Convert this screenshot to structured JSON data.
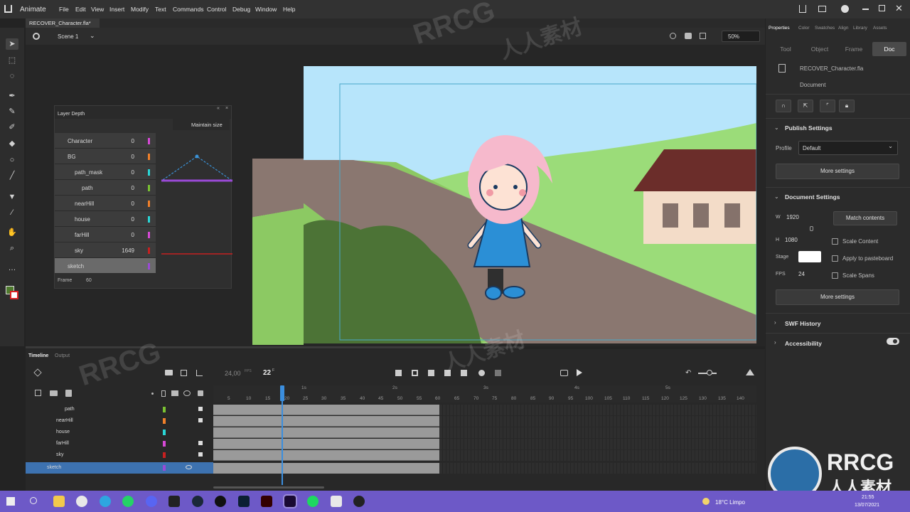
{
  "app": {
    "name": "Animate",
    "menus": [
      "File",
      "Edit",
      "View",
      "Insert",
      "Modify",
      "Text",
      "Commands",
      "Control",
      "Debug",
      "Window",
      "Help"
    ]
  },
  "document_tab": {
    "title": "RECOVER_Character.fla*",
    "close": "×"
  },
  "scene": {
    "label": "Scene 1",
    "zoom": "50%"
  },
  "layer_depth": {
    "title": "Layer Depth",
    "maintain_size": "Maintain size",
    "frame_label": "Frame",
    "frame_value": "60",
    "layers": [
      {
        "name": "Character",
        "depth": "0",
        "color": "#d649d6"
      },
      {
        "name": "BG",
        "depth": "0",
        "color": "#f0802a"
      },
      {
        "name": "path_mask",
        "depth": "0",
        "color": "#2ad6d6"
      },
      {
        "name": "path",
        "depth": "0",
        "color": "#7ac232"
      },
      {
        "name": "nearHill",
        "depth": "0",
        "color": "#f0802a"
      },
      {
        "name": "house",
        "depth": "0",
        "color": "#2ad6d6"
      },
      {
        "name": "farHill",
        "depth": "0",
        "color": "#d649d6"
      },
      {
        "name": "sky",
        "depth": "1649",
        "color": "#c62020"
      },
      {
        "name": "sketch",
        "depth": "",
        "color": "#9a4ad6"
      }
    ]
  },
  "properties": {
    "tabs": [
      "Properties",
      "Color",
      "Swatches",
      "Align",
      "Library",
      "Assets"
    ],
    "segments": [
      "Tool",
      "Object",
      "Frame",
      "Doc"
    ],
    "doc_name": "RECOVER_Character.fla",
    "doc_type": "Document",
    "publish": {
      "title": "Publish Settings",
      "profile_label": "Profile",
      "profile": "Default",
      "more": "More settings"
    },
    "document": {
      "title": "Document Settings",
      "w_label": "W",
      "w": "1920",
      "h_label": "H",
      "h": "1080",
      "match": "Match contents",
      "scale_content": "Scale Content",
      "stage_label": "Stage",
      "apply_pasteboard": "Apply to pasteboard",
      "fps_label": "FPS",
      "fps": "24",
      "scale_spans": "Scale Spans",
      "more": "More settings"
    },
    "swf_history": "SWF History",
    "accessibility": "Accessibility"
  },
  "timeline": {
    "tab": "Timeline",
    "output": "Output",
    "fps": "24,00",
    "fps_unit": "FPS",
    "frame": "22",
    "frame_unit": "F",
    "ruler": [
      "5",
      "10",
      "15",
      "20",
      "25",
      "30",
      "35",
      "40",
      "45",
      "50",
      "55",
      "60",
      "65",
      "70",
      "75",
      "80",
      "85",
      "90",
      "95",
      "100",
      "105",
      "110",
      "115",
      "120",
      "125",
      "130",
      "135",
      "140"
    ],
    "seconds": [
      "1s",
      "2s",
      "3s",
      "4s",
      "5s"
    ],
    "layers": [
      {
        "name": "path",
        "color": "#7ac232",
        "locked": true
      },
      {
        "name": "nearHill",
        "color": "#f0802a",
        "locked": true
      },
      {
        "name": "house",
        "color": "#2ad6d6",
        "locked": false
      },
      {
        "name": "farHill",
        "color": "#d649d6",
        "locked": true
      },
      {
        "name": "sky",
        "color": "#c62020",
        "locked": true
      },
      {
        "name": "sketch",
        "color": "#9a4ad6",
        "locked": false
      }
    ]
  },
  "taskbar": {
    "weather": "18°C  Limpo",
    "time": "21:55",
    "date": "13/07/2021"
  },
  "watermarks": [
    "RRCG",
    "人人素材",
    "RRCG",
    "人人素材"
  ],
  "logo": {
    "line1": "RRCG",
    "line2": "人人素材"
  }
}
